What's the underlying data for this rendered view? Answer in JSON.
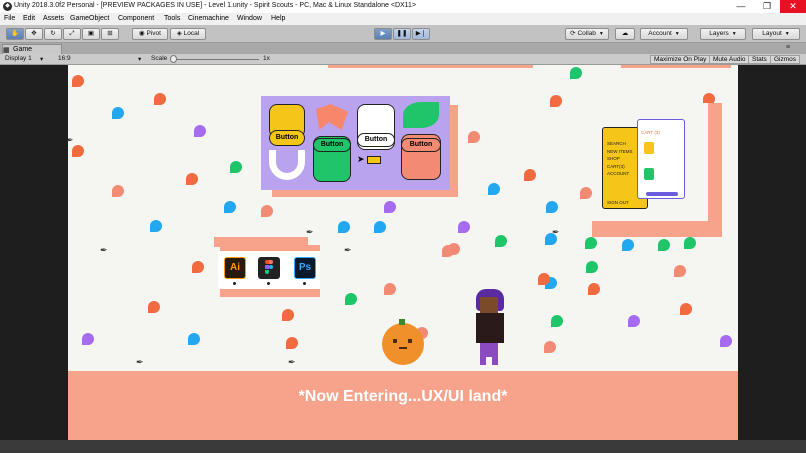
{
  "window": {
    "title": "Unity 2018.3.0f2 Personal - [PREVIEW PACKAGES IN USE] - Level 1.unity - Spirit Scouts - PC, Mac & Linux Standalone <DX11>",
    "minimize": "—",
    "maximize": "❐",
    "close": "✕"
  },
  "menu": [
    "File",
    "Edit",
    "Assets",
    "GameObject",
    "Component",
    "Tools",
    "Cinemachine",
    "Window",
    "Help"
  ],
  "toolbar": {
    "pivot": "Pivot",
    "local": "Local",
    "collab": "Collab",
    "account": "Account",
    "layers": "Layers",
    "layout": "Layout"
  },
  "game_tab": {
    "label": "Game",
    "display": "Display 1",
    "aspect": "16:9",
    "scale_label": "Scale",
    "scale_value": "1x",
    "maximize_on_play": "Maximize On Play",
    "mute_audio": "Mute Audio",
    "stats": "Stats",
    "gizmos": "Gizmos"
  },
  "scene": {
    "buttons": [
      "Button",
      "Button",
      "Button",
      "Button"
    ],
    "app_icons": [
      "Ai",
      "Ps"
    ],
    "mobile_menu": [
      "SEARCH",
      "NEW ITEMS",
      "SHOP",
      "CART(3)",
      "ACCOUNT",
      "SIGN OUT"
    ],
    "cart_title": "CART (3)",
    "banner_text": "*Now Entering...UX/UI land*"
  },
  "colors": {
    "accent_coral": "#f7a28a",
    "purple_panel": "#b9a3ef",
    "yellow": "#f5c518",
    "green": "#20c56a"
  }
}
